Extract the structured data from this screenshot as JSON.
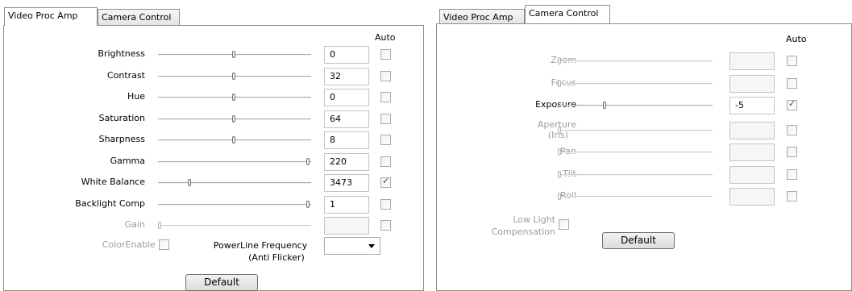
{
  "left": {
    "tabs": [
      {
        "label": "Video Proc Amp"
      },
      {
        "label": "Camera Control"
      }
    ],
    "auto_label": "Auto",
    "rows": [
      {
        "label": "Brightness",
        "value": "0",
        "auto": false,
        "level": 0.5
      },
      {
        "label": "Contrast",
        "value": "32",
        "auto": false,
        "level": 0.5
      },
      {
        "label": "Hue",
        "value": "0",
        "auto": false,
        "level": 0.5
      },
      {
        "label": "Saturation",
        "value": "64",
        "auto": false,
        "level": 0.5
      },
      {
        "label": "Sharpness",
        "value": "8",
        "auto": false,
        "level": 0.5
      },
      {
        "label": "Gamma",
        "value": "220",
        "auto": false,
        "level": 1.0
      },
      {
        "label": "White Balance",
        "value": "3473",
        "auto": true,
        "level": 0.2
      },
      {
        "label": "Backlight Comp",
        "value": "1",
        "auto": false,
        "level": 1.0
      },
      {
        "label": "Gain",
        "value": "",
        "auto": false,
        "level": 0.0,
        "disabled": true
      }
    ],
    "color_enable_label": "ColorEnable",
    "powerline_label_line1": "PowerLine Frequency",
    "powerline_label_line2": "(Anti Flicker)",
    "powerline_value": "",
    "default_label": "Default"
  },
  "right": {
    "tabs": [
      {
        "label": "Video Proc Amp"
      },
      {
        "label": "Camera Control"
      }
    ],
    "auto_label": "Auto",
    "rows": [
      {
        "label": "Zoom",
        "value": "",
        "auto": false,
        "level": 0.0,
        "disabled": true
      },
      {
        "label": "Focus",
        "value": "",
        "auto": false,
        "level": 0.0,
        "disabled": true
      },
      {
        "label": "Exposure",
        "value": "-5",
        "auto": true,
        "level": 0.3
      },
      {
        "label": "Aperture",
        "label2": "(Iris)",
        "value": "",
        "auto": false,
        "level": 0.0,
        "disabled": true
      },
      {
        "label": "Pan",
        "value": "",
        "auto": false,
        "level": 0.0,
        "disabled": true
      },
      {
        "label": "Tilt",
        "value": "",
        "auto": false,
        "level": 0.0,
        "disabled": true
      },
      {
        "label": "Roll",
        "value": "",
        "auto": false,
        "level": 0.0,
        "disabled": true
      }
    ],
    "lowlight_line1": "Low Light",
    "lowlight_line2": "Compensation",
    "default_label": "Default"
  }
}
